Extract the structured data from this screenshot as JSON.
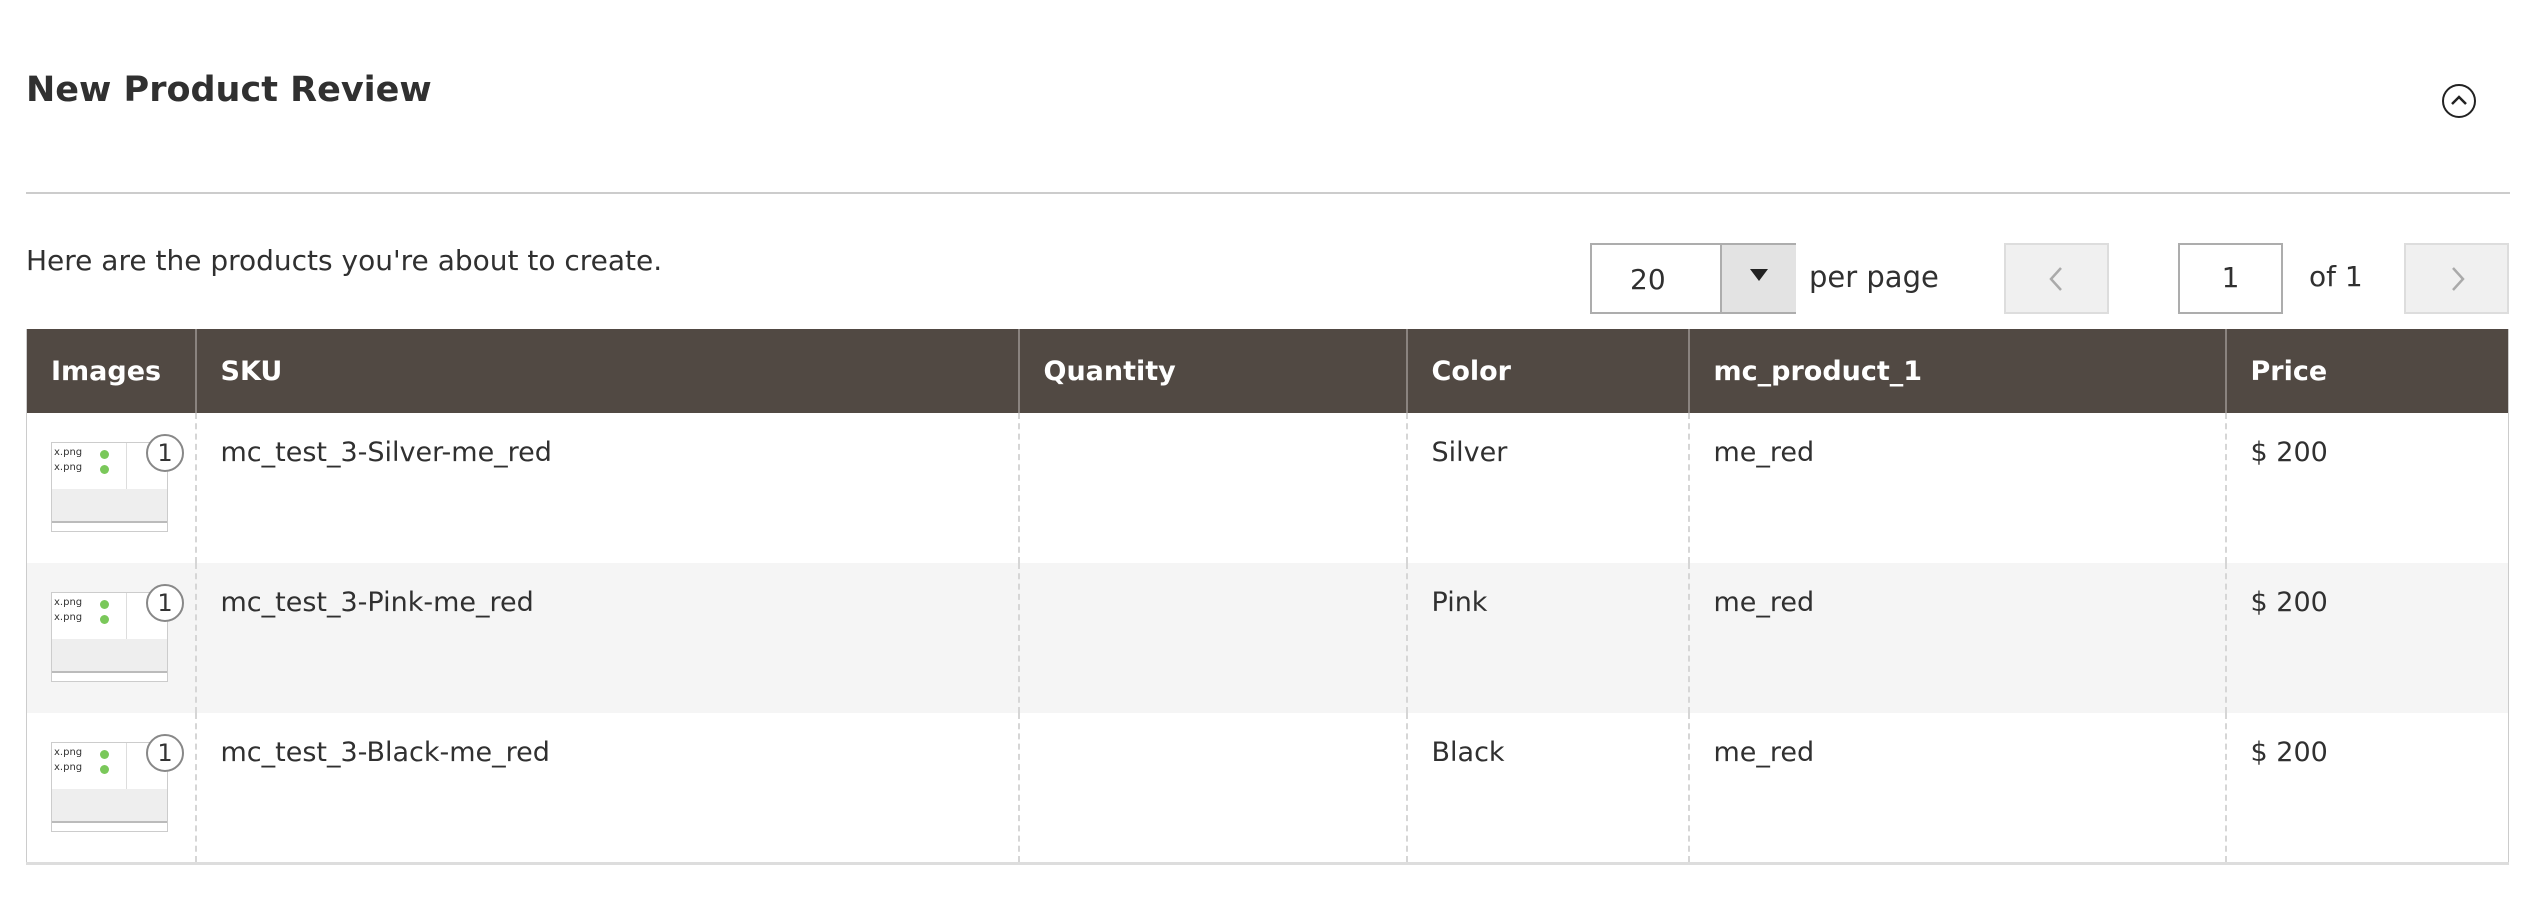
{
  "section": {
    "title": "New Product Review",
    "collapse_icon": "chevron-up-circle-icon"
  },
  "intro_text": "Here are the products you're about to create.",
  "pager": {
    "per_page_value": "20",
    "per_page_label": "per page",
    "page_value": "1",
    "of_label": "of 1",
    "prev_icon": "chevron-left-icon",
    "next_icon": "chevron-right-icon"
  },
  "table": {
    "columns": [
      "Images",
      "SKU",
      "Quantity",
      "Color",
      "mc_product_1",
      "Price"
    ],
    "rows": [
      {
        "image_count": "1",
        "thumb_lines": [
          "x.png",
          "x.png"
        ],
        "sku": "mc_test_3-Silver-me_red",
        "quantity": "",
        "color": "Silver",
        "mc_product_1": "me_red",
        "price": "$ 200"
      },
      {
        "image_count": "1",
        "thumb_lines": [
          "x.png",
          "x.png"
        ],
        "sku": "mc_test_3-Pink-me_red",
        "quantity": "",
        "color": "Pink",
        "mc_product_1": "me_red",
        "price": "$ 200"
      },
      {
        "image_count": "1",
        "thumb_lines": [
          "x.png",
          "x.png"
        ],
        "sku": "mc_test_3-Black-me_red",
        "quantity": "",
        "color": "Black",
        "mc_product_1": "me_red",
        "price": "$ 200"
      }
    ]
  },
  "colors": {
    "header_bg": "#514943",
    "alt_row_bg": "#f5f5f5",
    "thumb_dot": "#7ac85a"
  }
}
